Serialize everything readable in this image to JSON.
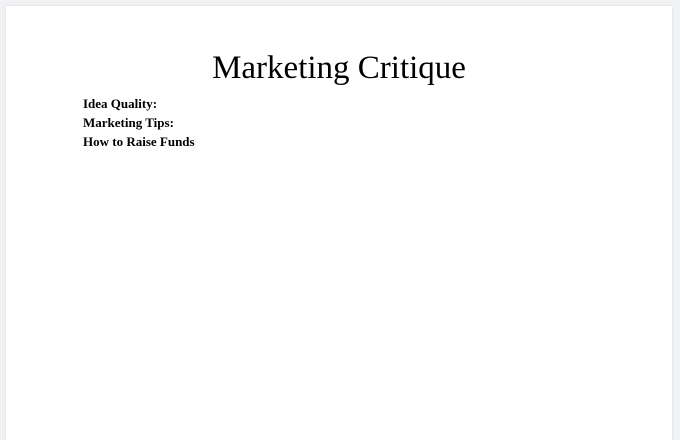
{
  "document": {
    "title": "Marketing Critique",
    "fields": [
      "Idea Quality:",
      "Marketing Tips:",
      "How to Raise Funds"
    ]
  }
}
